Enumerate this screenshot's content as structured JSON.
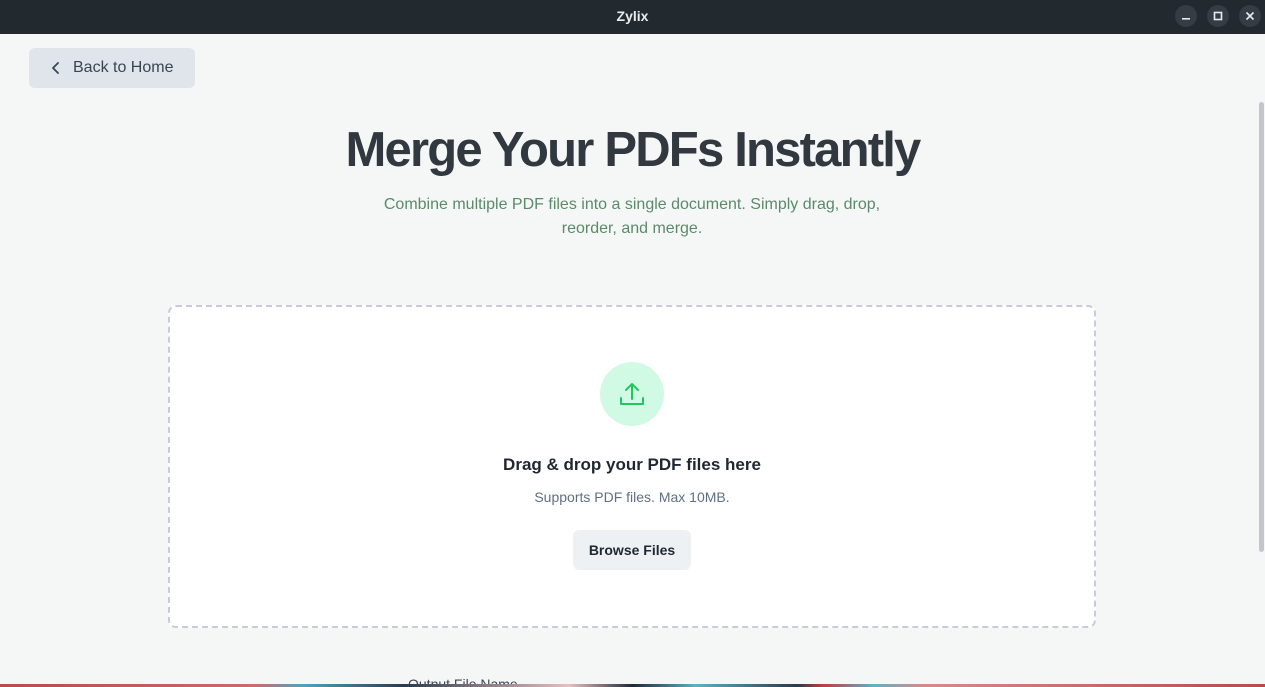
{
  "window": {
    "title": "Zylix",
    "controls": {
      "minimize_icon": "minimize-icon",
      "maximize_icon": "maximize-icon",
      "close_icon": "close-icon"
    }
  },
  "nav": {
    "back_label": "Back to Home",
    "back_icon": "chevron-left-icon"
  },
  "hero": {
    "title": "Merge Your PDFs Instantly",
    "subtitle": "Combine multiple PDF files into a single document. Simply drag, drop, reorder, and merge."
  },
  "dropzone": {
    "icon": "upload-icon",
    "title": "Drag & drop your PDF files here",
    "hint": "Supports PDF files. Max 10MB.",
    "browse_label": "Browse Files"
  },
  "output": {
    "label": "Output File Name"
  },
  "colors": {
    "titlebar": "#222a30",
    "accent_green": "#22c55e",
    "accent_green_bg": "#d1fae5",
    "subtitle": "#5b8a6b",
    "heading": "#323840"
  }
}
